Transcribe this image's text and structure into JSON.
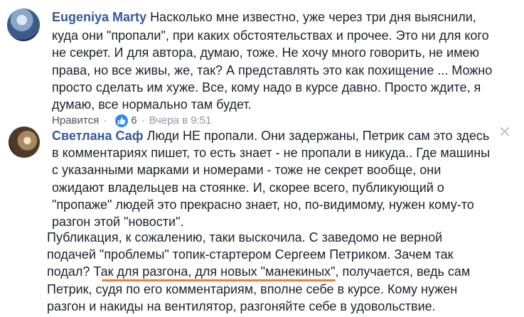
{
  "comment1": {
    "author": "Eugeniya Marty",
    "lines": [
      "Насколько мне известно, уже через три дня выяснили,",
      "куда они \"пропали\", при каких обстоятельствах и прочее. Это ни для кого",
      "не секрет. И для автора, думаю, тоже. Не хочу много говорить, не имею",
      "права, но все живы, же, так? А представлять это как похищение ... Можно",
      "просто сделать им хуже. Все, кому надо в курсе давно. Просто ждите, я",
      "думаю, все нормально там будет."
    ],
    "like_label": "Нравится",
    "sep": "·",
    "reaction_count": "6",
    "timestamp": "Вчера в 9:51"
  },
  "comment2": {
    "author": "Светлана Саф",
    "lines": [
      "Люди НЕ пропали. Они задержаны, Петрик сам это здесь",
      "в комментариях пишет, то есть знает - не пропали в никуда.. Где машины",
      "с указанными марками и номерами - тоже не секрет вообще, они",
      "ожидают владельцев на стоянке. И, скорее всего, публикующий о",
      "\"пропаже\" людей это прекрасно знает, но, по-видимому, нужен кому-то",
      "разгон этой \"новости\"."
    ]
  },
  "reply_text": {
    "lines": [
      "Публикация, к сожалению, таки выскочила. С заведомо не верной",
      "подачей \"проблемы\" топик-стартером Сергеем Петриком. Зачем так",
      "подал? Так для разгона, для новых \"манекиных\", получается, ведь сам",
      "Петрик, судя по его комментариям, вполне себе в курсе. Кому нужен",
      "разгон и накиды на вентилятор, разгоняйте себе в удовольствие."
    ]
  },
  "colors": {
    "name": "#365899",
    "text": "#1d2129",
    "meta": "#90949c",
    "like_blue": "#2d88ff",
    "underline": "#f07f2c"
  },
  "icons": [
    "avatar",
    "like-thumb-icon",
    "close-icon"
  ]
}
